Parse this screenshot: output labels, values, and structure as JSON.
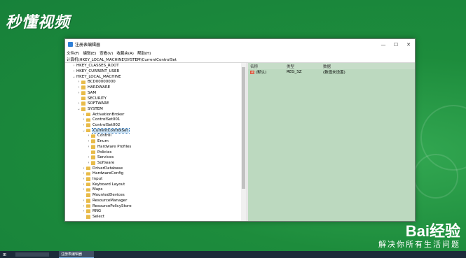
{
  "overlay": {
    "logo_text": "秒懂视频",
    "baidu_text": "Bai经验",
    "baidu_sub": "解决你所有生活问题"
  },
  "window": {
    "title": "注册表编辑器",
    "controls": {
      "minimize": "—",
      "maximize": "☐",
      "close": "✕"
    },
    "menu": [
      "文件(F)",
      "编辑(E)",
      "查看(V)",
      "收藏夹(A)",
      "帮助(H)"
    ],
    "address": "计算机\\HKEY_LOCAL_MACHINE\\SYSTEM\\CurrentControlSet"
  },
  "tree": [
    {
      "label": "HKEY_CLASSES_ROOT",
      "level": 1,
      "expander": "›"
    },
    {
      "label": "HKEY_CURRENT_USER",
      "level": 1,
      "expander": "›"
    },
    {
      "label": "HKEY_LOCAL_MACHINE",
      "level": 1,
      "expander": "⌄"
    },
    {
      "label": "BCD00000000",
      "level": 2,
      "expander": "›"
    },
    {
      "label": "HARDWARE",
      "level": 2,
      "expander": "›"
    },
    {
      "label": "SAM",
      "level": 2,
      "expander": "›"
    },
    {
      "label": "SECURITY",
      "level": 2,
      "expander": ""
    },
    {
      "label": "SOFTWARE",
      "level": 2,
      "expander": "›"
    },
    {
      "label": "SYSTEM",
      "level": 2,
      "expander": "⌄"
    },
    {
      "label": "ActivationBroker",
      "level": 3,
      "expander": "›"
    },
    {
      "label": "ControlSet001",
      "level": 3,
      "expander": "›"
    },
    {
      "label": "ControlSet002",
      "level": 3,
      "expander": "›"
    },
    {
      "label": "CurrentControlSet",
      "level": 3,
      "expander": "⌄",
      "selected": true
    },
    {
      "label": "Control",
      "level": 4,
      "expander": "›"
    },
    {
      "label": "Enum",
      "level": 4,
      "expander": "›"
    },
    {
      "label": "Hardware Profiles",
      "level": 4,
      "expander": "›"
    },
    {
      "label": "Policies",
      "level": 4,
      "expander": ""
    },
    {
      "label": "Services",
      "level": 4,
      "expander": "›"
    },
    {
      "label": "Software",
      "level": 4,
      "expander": "›"
    },
    {
      "label": "DriverDatabase",
      "level": 3,
      "expander": "›"
    },
    {
      "label": "HardwareConfig",
      "level": 3,
      "expander": "›"
    },
    {
      "label": "Input",
      "level": 3,
      "expander": "›"
    },
    {
      "label": "Keyboard Layout",
      "level": 3,
      "expander": "›"
    },
    {
      "label": "Maps",
      "level": 3,
      "expander": "›"
    },
    {
      "label": "MountedDevices",
      "level": 3,
      "expander": ""
    },
    {
      "label": "ResourceManager",
      "level": 3,
      "expander": "›"
    },
    {
      "label": "ResourcePolicyStore",
      "level": 3,
      "expander": "›"
    },
    {
      "label": "RNG",
      "level": 3,
      "expander": "›"
    },
    {
      "label": "Select",
      "level": 3,
      "expander": ""
    }
  ],
  "values_pane": {
    "headers": {
      "name": "名称",
      "type": "类型",
      "data": "数据"
    },
    "rows": [
      {
        "icon": "ab",
        "name": "(默认)",
        "type": "REG_SZ",
        "data": "(数值未设置)"
      }
    ]
  },
  "taskbar": {
    "start_icon": "windows-icon",
    "task_label": "注册表编辑器"
  }
}
